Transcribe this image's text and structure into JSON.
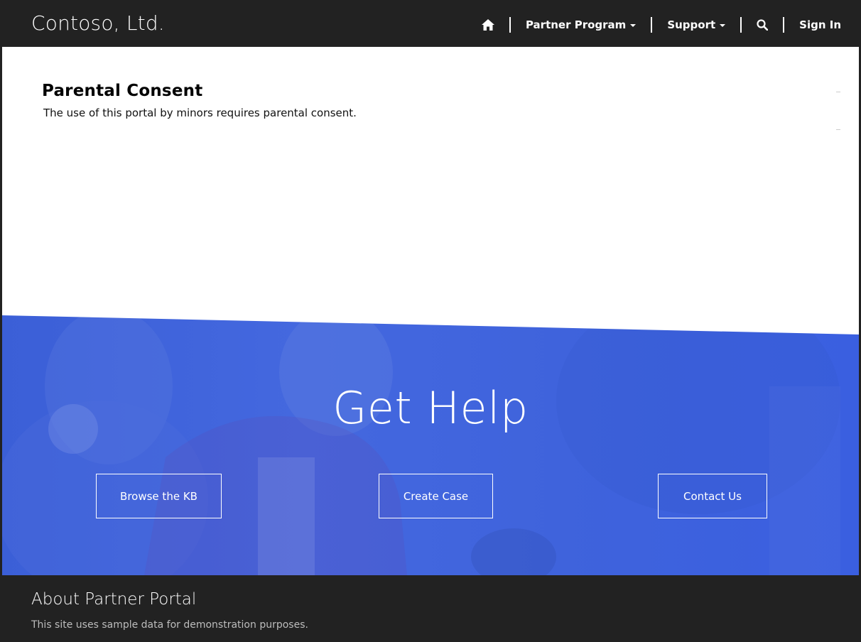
{
  "navbar": {
    "brand": "Contoso, Ltd.",
    "home_icon": "home-icon",
    "items": [
      {
        "label": "Partner Program",
        "has_dropdown": true
      },
      {
        "label": "Support",
        "has_dropdown": true
      }
    ],
    "search_icon": "search-icon",
    "sign_in": "Sign In"
  },
  "main": {
    "title": "Parental Consent",
    "text": "The use of this portal by minors requires parental consent."
  },
  "help": {
    "title": "Get Help",
    "buttons": [
      {
        "label": "Browse the KB"
      },
      {
        "label": "Create Case"
      },
      {
        "label": "Contact Us"
      }
    ]
  },
  "footer": {
    "title": "About Partner Portal",
    "text": "This site uses sample data for demonstration purposes."
  },
  "colors": {
    "navbar_bg": "#222222",
    "accent_blue": "#3f63dc",
    "footer_bg": "#222222",
    "text_white": "#ffffff"
  }
}
